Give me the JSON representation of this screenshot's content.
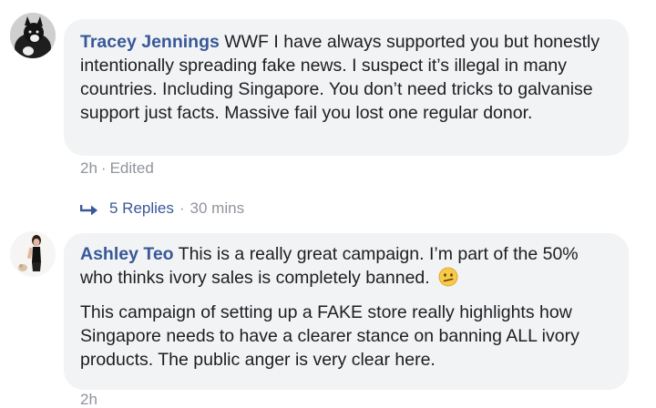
{
  "comments": [
    {
      "author": "Tracey Jennings",
      "avatar_icon": "pet-photo-avatar",
      "paragraphs": [
        "WWF I have always supported you but honestly intentionally spreading fake news. I suspect it’s illegal in many countries. Including Singapore. You don’t need tricks to galvanise support just facts. Massive fail you lost one regular donor."
      ],
      "time": "2h",
      "separator": "·",
      "edited": "Edited",
      "replies": {
        "icon": "reply-arrow-icon",
        "label": "5 Replies",
        "time": "30 mins"
      }
    },
    {
      "author": "Ashley Teo",
      "avatar_icon": "person-photo-avatar",
      "paragraphs": [
        "This is a really great campaign. I’m part of the 50% who thinks ivory sales is completely banned.",
        "This campaign of setting up a FAKE store really highlights how Singapore needs to have a clearer stance on banning ALL ivory products. The public anger is very clear here."
      ],
      "emoji": "confused-face-emoji",
      "time": "2h"
    }
  ],
  "colors": {
    "author": "#385898",
    "bubble": "#f2f3f5",
    "meta": "#90949c",
    "text": "#1c1e21"
  }
}
